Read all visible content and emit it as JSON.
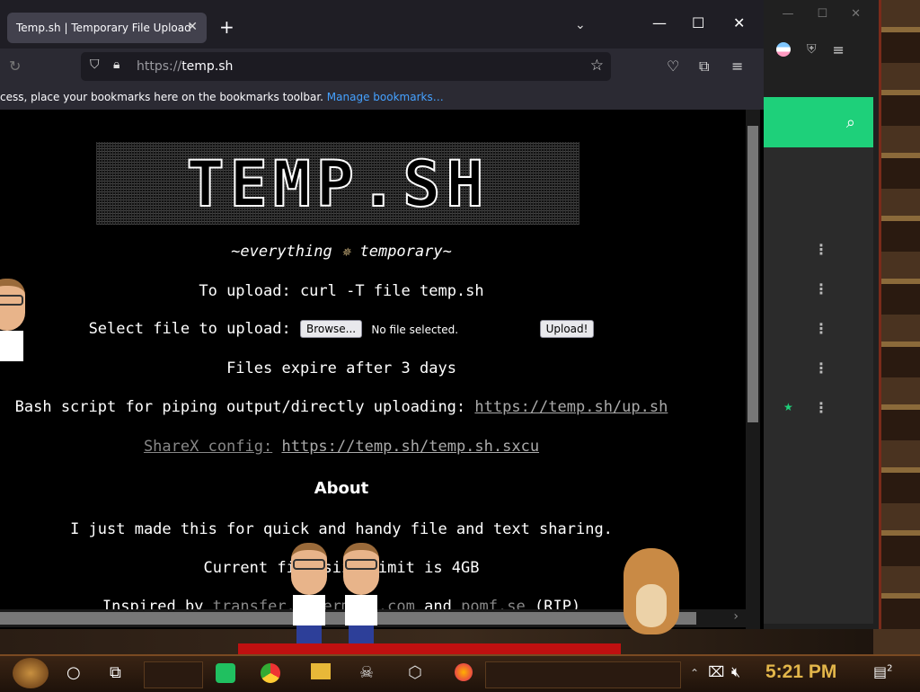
{
  "browser": {
    "tab_title": "Temp.sh | Temporary File Upload",
    "tab_close": "✕",
    "new_tab": "+",
    "tab_list": "⌄",
    "minimize": "—",
    "maximize": "☐",
    "close": "✕",
    "url_prefix": "https://",
    "url_host": "temp.sh",
    "bookmarks_text": "cess, place your bookmarks here on the bookmarks toolbar.",
    "bookmarks_link": "Manage bookmarks…"
  },
  "page": {
    "logo": "TEMP.SH",
    "tagline_left": "~everything",
    "tagline_right": "temporary~",
    "upload_cmd": "To upload: curl -T file temp.sh",
    "select_label": "Select file to upload:",
    "browse_label": "Browse...",
    "no_file": "No file selected.",
    "upload_label": "Upload!",
    "expire": "Files expire after 3 days",
    "bash_label": "Bash script for piping output/directly uploading:",
    "bash_link": "https://temp.sh/up.sh",
    "sharex_label": "ShareX config:",
    "sharex_link": "https://temp.sh/temp.sh.sxcu",
    "about_heading": "About",
    "about_text": "I just made this for quick and handy file and text sharing.",
    "limit_text": "Current file size limit is 4GB",
    "inspired_prefix": "Inspired by",
    "inspired_link1": "transfer.sh",
    "inspired_link2": "termbin.com",
    "inspired_and": "and",
    "inspired_link3": "pomf.se",
    "inspired_suffix": "(RIP)"
  },
  "taskbar": {
    "time": "5:21 PM",
    "notification_count": "2"
  },
  "colors": {
    "accent_green": "#1ed07a",
    "clock_gold": "#e3b64a",
    "link_blue": "#45a1ff"
  }
}
